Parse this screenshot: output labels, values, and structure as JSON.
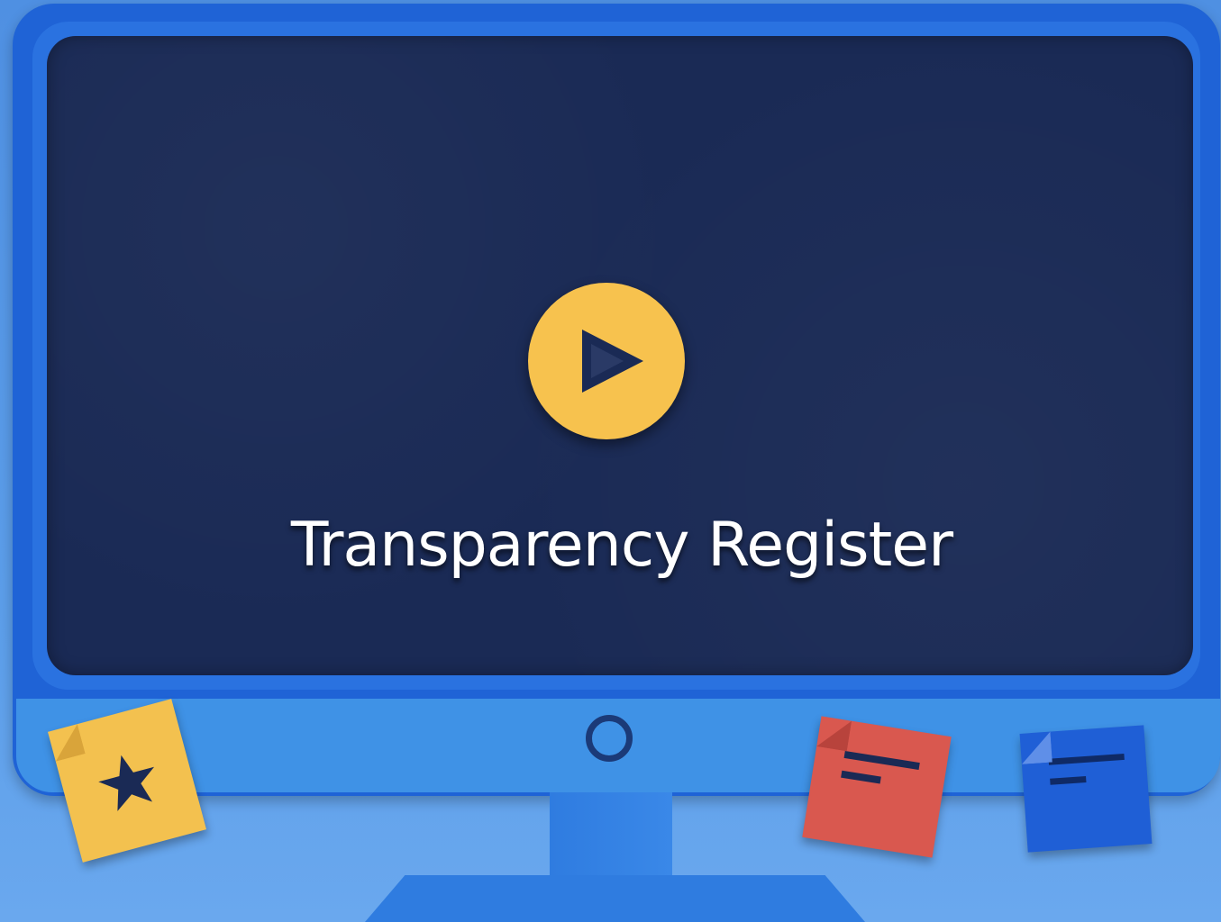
{
  "video": {
    "title": "Transparency Register",
    "play_icon": "play-icon"
  },
  "decorations": {
    "icons": [
      "star-icon",
      "note-lines-icon",
      "note-lines-icon"
    ]
  },
  "colors": {
    "background": "#5a9be6",
    "monitor_frame": "#1f63d6",
    "screen": "#1a2a55",
    "chin": "#3f92e6",
    "play_button": "#f7c24e",
    "title_text": "#ffffff",
    "note_yellow": "#f3c14f",
    "note_red": "#d9584f",
    "note_blue": "#1f5fd6"
  }
}
